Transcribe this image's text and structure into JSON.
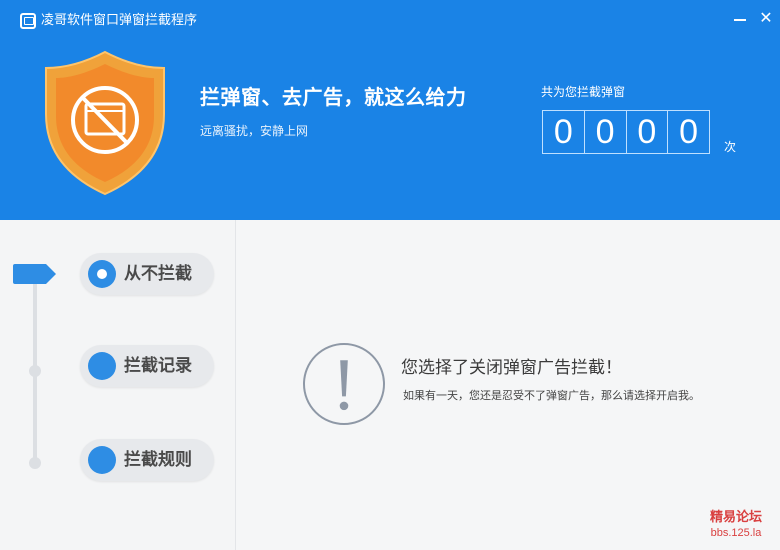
{
  "window": {
    "title": "凌哥软件窗口弹窗拦截程序",
    "minimize_icon": "minimize-icon",
    "close_glyph": "✕"
  },
  "header": {
    "slogan": "拦弹窗、去广告，就这么给力",
    "sub_slogan": "远离骚扰，安静上网",
    "counter_label": "共为您拦截弹窗",
    "counter_digits": [
      "0",
      "0",
      "0",
      "0"
    ],
    "counter_unit": "次",
    "shield_colors": {
      "outer": "#f0a23a",
      "inner": "#f28a2b",
      "line": "#ffffff"
    }
  },
  "sidebar": {
    "items": [
      {
        "label": "从不拦截",
        "selected": true
      },
      {
        "label": "拦截记录",
        "selected": false
      },
      {
        "label": "拦截规则",
        "selected": false
      }
    ]
  },
  "content": {
    "alert_title": "您选择了关闭弹窗广告拦截！",
    "alert_desc": "如果有一天，您还是忍受不了弹窗广告，那么请选择开启我。"
  },
  "watermark": {
    "line1": "精易论坛",
    "line2": "bbs.125.la"
  },
  "colors": {
    "header_blue": "#1a83e6",
    "accent_blue": "#2e8de4",
    "watermark_red": "#d94040"
  }
}
